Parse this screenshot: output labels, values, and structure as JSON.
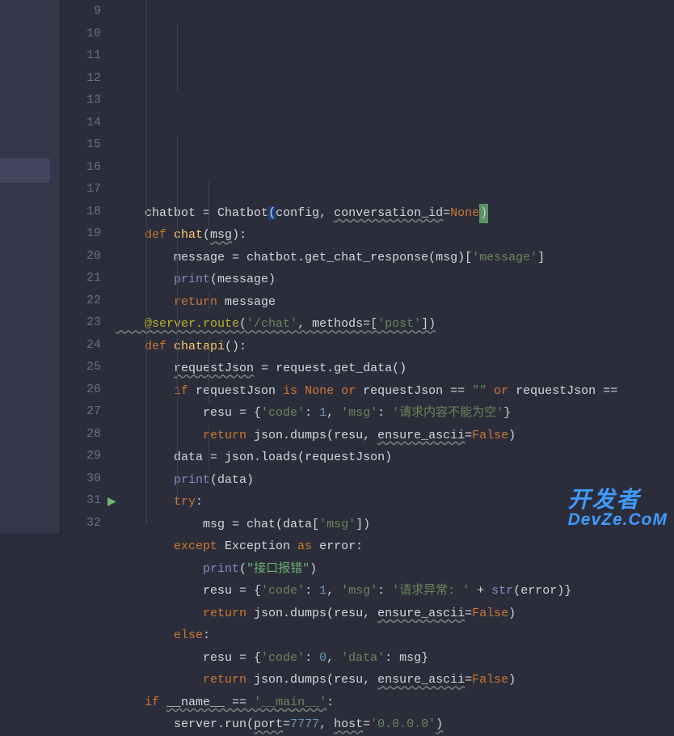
{
  "editor": {
    "firstLine": 9,
    "lastLine": 32,
    "lines": {
      "9": {
        "tokens": [
          {
            "cls": "var",
            "t": "    chatbot "
          },
          {
            "cls": "pun",
            "t": "= "
          },
          {
            "cls": "var",
            "t": "Chatbot"
          },
          {
            "cls": "pun hlbg",
            "t": "("
          },
          {
            "cls": "var",
            "t": "config"
          },
          {
            "cls": "pun",
            "t": ", "
          },
          {
            "cls": "param",
            "t": "conversation_id"
          },
          {
            "cls": "pun",
            "t": "="
          },
          {
            "cls": "self-kw",
            "t": "None"
          },
          {
            "cls": "pun cursor-box",
            "t": ")"
          }
        ]
      },
      "10": {
        "tokens": [
          {
            "cls": "kw",
            "t": "    def "
          },
          {
            "cls": "fn",
            "t": "chat"
          },
          {
            "cls": "pun",
            "t": "("
          },
          {
            "cls": "var underl",
            "t": "msg"
          },
          {
            "cls": "pun",
            "t": "):"
          }
        ]
      },
      "11": {
        "tokens": [
          {
            "cls": "var",
            "t": "        message "
          },
          {
            "cls": "pun",
            "t": "= "
          },
          {
            "cls": "var",
            "t": "chatbot.get_chat_response(msg)["
          },
          {
            "cls": "str",
            "t": "'message'"
          },
          {
            "cls": "pun",
            "t": "]"
          }
        ]
      },
      "12": {
        "tokens": [
          {
            "cls": "var",
            "t": "        "
          },
          {
            "cls": "builtin",
            "t": "print"
          },
          {
            "cls": "pun",
            "t": "(message)"
          }
        ]
      },
      "13": {
        "tokens": [
          {
            "cls": "var",
            "t": "        "
          },
          {
            "cls": "kw",
            "t": "return "
          },
          {
            "cls": "var",
            "t": "message"
          }
        ]
      },
      "14": {
        "tokens": [
          {
            "cls": "dec underl",
            "t": "    @server.route"
          },
          {
            "cls": "pun underl",
            "t": "("
          },
          {
            "cls": "str underl",
            "t": "'/chat'"
          },
          {
            "cls": "pun underl",
            "t": ", "
          },
          {
            "cls": "param",
            "t": "methods"
          },
          {
            "cls": "pun underl",
            "t": "=["
          },
          {
            "cls": "str underl",
            "t": "'post'"
          },
          {
            "cls": "pun underl",
            "t": "])"
          }
        ]
      },
      "15": {
        "tokens": [
          {
            "cls": "kw",
            "t": "    def "
          },
          {
            "cls": "fn",
            "t": "chatapi"
          },
          {
            "cls": "pun",
            "t": "():"
          }
        ]
      },
      "16": {
        "tokens": [
          {
            "cls": "var",
            "t": "        "
          },
          {
            "cls": "var underl",
            "t": "requestJson"
          },
          {
            "cls": "var",
            "t": " "
          },
          {
            "cls": "pun",
            "t": "= "
          },
          {
            "cls": "var",
            "t": "request.get_data()"
          }
        ]
      },
      "17": {
        "tokens": [
          {
            "cls": "var",
            "t": "        "
          },
          {
            "cls": "kw",
            "t": "if "
          },
          {
            "cls": "var",
            "t": "requestJson "
          },
          {
            "cls": "kw",
            "t": "is None or "
          },
          {
            "cls": "var",
            "t": "requestJson == "
          },
          {
            "cls": "str",
            "t": "\"\""
          },
          {
            "cls": "var",
            "t": " "
          },
          {
            "cls": "kw",
            "t": "or "
          },
          {
            "cls": "var",
            "t": "requestJson =="
          }
        ]
      },
      "18": {
        "tokens": [
          {
            "cls": "var",
            "t": "            resu "
          },
          {
            "cls": "pun",
            "t": "= {"
          },
          {
            "cls": "str",
            "t": "'code'"
          },
          {
            "cls": "pun",
            "t": ": "
          },
          {
            "cls": "num",
            "t": "1"
          },
          {
            "cls": "pun",
            "t": ", "
          },
          {
            "cls": "str",
            "t": "'msg'"
          },
          {
            "cls": "pun",
            "t": ": "
          },
          {
            "cls": "str",
            "t": "'请求内容不能为空'"
          },
          {
            "cls": "pun",
            "t": "}"
          }
        ]
      },
      "19": {
        "tokens": [
          {
            "cls": "var",
            "t": "            "
          },
          {
            "cls": "kw",
            "t": "return "
          },
          {
            "cls": "var",
            "t": "json.dumps(resu"
          },
          {
            "cls": "pun",
            "t": ", "
          },
          {
            "cls": "param",
            "t": "ensure_ascii"
          },
          {
            "cls": "pun",
            "t": "="
          },
          {
            "cls": "kw",
            "t": "False"
          },
          {
            "cls": "pun",
            "t": ")"
          }
        ]
      },
      "20": {
        "tokens": [
          {
            "cls": "var",
            "t": "        data "
          },
          {
            "cls": "pun",
            "t": "= "
          },
          {
            "cls": "var",
            "t": "json.loads(requestJson)"
          }
        ]
      },
      "21": {
        "tokens": [
          {
            "cls": "var",
            "t": "        "
          },
          {
            "cls": "builtin",
            "t": "print"
          },
          {
            "cls": "pun",
            "t": "(data)"
          }
        ]
      },
      "22": {
        "tokens": [
          {
            "cls": "var",
            "t": "        "
          },
          {
            "cls": "kw",
            "t": "try"
          },
          {
            "cls": "pun",
            "t": ":"
          }
        ]
      },
      "23": {
        "tokens": [
          {
            "cls": "var",
            "t": "            msg "
          },
          {
            "cls": "pun",
            "t": "= "
          },
          {
            "cls": "var",
            "t": "chat(data["
          },
          {
            "cls": "str",
            "t": "'msg'"
          },
          {
            "cls": "pun",
            "t": "])"
          }
        ]
      },
      "24": {
        "tokens": [
          {
            "cls": "var",
            "t": "        "
          },
          {
            "cls": "kw",
            "t": "except "
          },
          {
            "cls": "var",
            "t": "Exception "
          },
          {
            "cls": "kw",
            "t": "as "
          },
          {
            "cls": "var",
            "t": "error:"
          }
        ]
      },
      "25": {
        "tokens": [
          {
            "cls": "var",
            "t": "            "
          },
          {
            "cls": "builtin",
            "t": "print"
          },
          {
            "cls": "pun",
            "t": "("
          },
          {
            "cls": "strb",
            "t": "\"接口报错\""
          },
          {
            "cls": "pun",
            "t": ")"
          }
        ]
      },
      "26": {
        "tokens": [
          {
            "cls": "var",
            "t": "            resu "
          },
          {
            "cls": "pun",
            "t": "= {"
          },
          {
            "cls": "str",
            "t": "'code'"
          },
          {
            "cls": "pun",
            "t": ": "
          },
          {
            "cls": "num",
            "t": "1"
          },
          {
            "cls": "pun",
            "t": ", "
          },
          {
            "cls": "str",
            "t": "'msg'"
          },
          {
            "cls": "pun",
            "t": ": "
          },
          {
            "cls": "str",
            "t": "'请求异常: '"
          },
          {
            "cls": "var",
            "t": " + "
          },
          {
            "cls": "builtin",
            "t": "str"
          },
          {
            "cls": "pun",
            "t": "(error)}"
          }
        ]
      },
      "27": {
        "tokens": [
          {
            "cls": "var",
            "t": "            "
          },
          {
            "cls": "kw",
            "t": "return "
          },
          {
            "cls": "var",
            "t": "json.dumps(resu"
          },
          {
            "cls": "pun",
            "t": ", "
          },
          {
            "cls": "param",
            "t": "ensure_ascii"
          },
          {
            "cls": "pun",
            "t": "="
          },
          {
            "cls": "kw",
            "t": "False"
          },
          {
            "cls": "pun",
            "t": ")"
          }
        ]
      },
      "28": {
        "tokens": [
          {
            "cls": "var",
            "t": "        "
          },
          {
            "cls": "kw",
            "t": "else"
          },
          {
            "cls": "pun",
            "t": ":"
          }
        ]
      },
      "29": {
        "tokens": [
          {
            "cls": "var",
            "t": "            resu "
          },
          {
            "cls": "pun",
            "t": "= {"
          },
          {
            "cls": "str",
            "t": "'code'"
          },
          {
            "cls": "pun",
            "t": ": "
          },
          {
            "cls": "num",
            "t": "0"
          },
          {
            "cls": "pun",
            "t": ", "
          },
          {
            "cls": "str",
            "t": "'data'"
          },
          {
            "cls": "pun",
            "t": ": msg}"
          }
        ]
      },
      "30": {
        "tokens": [
          {
            "cls": "var",
            "t": "            "
          },
          {
            "cls": "kw",
            "t": "return "
          },
          {
            "cls": "var",
            "t": "json.dumps(resu"
          },
          {
            "cls": "pun",
            "t": ", "
          },
          {
            "cls": "param",
            "t": "ensure_ascii"
          },
          {
            "cls": "pun",
            "t": "="
          },
          {
            "cls": "kw",
            "t": "False"
          },
          {
            "cls": "pun",
            "t": ")"
          }
        ]
      },
      "31": {
        "tokens": [
          {
            "cls": "var",
            "t": "    "
          },
          {
            "cls": "kw",
            "t": "if "
          },
          {
            "cls": "var underl",
            "t": "__name__ "
          },
          {
            "cls": "pun underl",
            "t": "== "
          },
          {
            "cls": "str underl",
            "t": "'__main__'"
          },
          {
            "cls": "pun",
            "t": ":"
          }
        ]
      },
      "32": {
        "tokens": [
          {
            "cls": "var",
            "t": "        server.run("
          },
          {
            "cls": "param",
            "t": "port"
          },
          {
            "cls": "pun",
            "t": "="
          },
          {
            "cls": "num",
            "t": "7777"
          },
          {
            "cls": "pun",
            "t": ", "
          },
          {
            "cls": "param",
            "t": "host"
          },
          {
            "cls": "pun",
            "t": "="
          },
          {
            "cls": "str",
            "t": "'0.0.0.0'"
          },
          {
            "cls": "pun underl",
            "t": ")"
          }
        ]
      }
    },
    "runMarkerLine": 31
  },
  "watermark": {
    "cn": "开发者",
    "en": "DevZe.CoM"
  }
}
